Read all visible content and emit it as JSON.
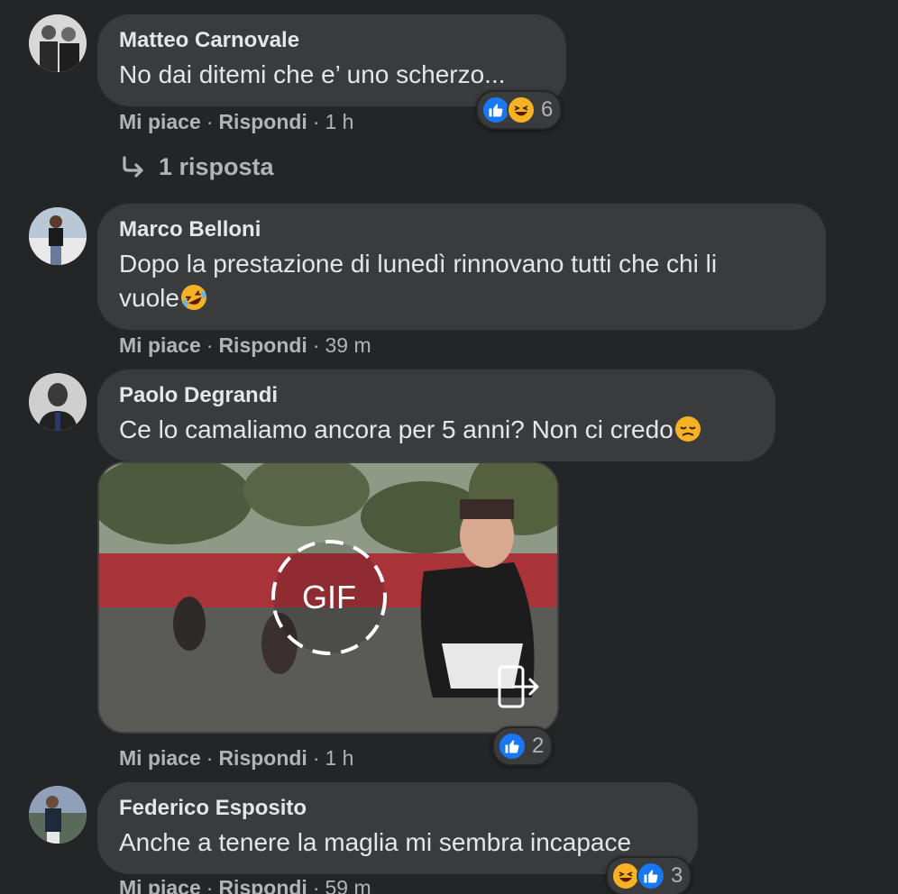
{
  "comments": [
    {
      "author": "Matteo Carnovale",
      "text": "No dai ditemi che e’ uno scherzo...",
      "like_label": "Mi piace",
      "reply_label": "Rispondi",
      "time": "1 h",
      "reaction_count": "6",
      "reaction_icons": [
        "like-icon",
        "haha-icon"
      ]
    },
    {
      "author": "Marco Belloni",
      "text_line1": "Dopo la prestazione di lunedì rinnovano tutti che chi li",
      "text_line2": "vuole",
      "text_emoji": "rolling-laughing-emoji",
      "like_label": "Mi piace",
      "reply_label": "Rispondi",
      "time": "39 m"
    },
    {
      "author": "Paolo Degrandi",
      "text": "Ce lo camaliamo ancora per 5 anni? Non ci credo",
      "text_emoji": "disappointed-emoji",
      "gif_label": "GIF",
      "like_label": "Mi piace",
      "reply_label": "Rispondi",
      "time": "1 h",
      "reaction_count": "2",
      "reaction_icons": [
        "like-icon"
      ]
    },
    {
      "author": "Federico Esposito",
      "text": "Anche a tenere la maglia mi sembra incapace",
      "like_label": "Mi piace",
      "reply_label": "Rispondi",
      "time": "59 m",
      "reaction_count": "3",
      "reaction_icons": [
        "haha-icon",
        "like-icon"
      ]
    }
  ],
  "replies_link": "1 risposta",
  "colors": {
    "background": "#242526",
    "bubble": "#3a3b3c",
    "primary_text": "#e4e6eb",
    "secondary_text": "#b0b3b8",
    "like_blue": "#1877f2",
    "haha_yellow": "#f7b125"
  }
}
